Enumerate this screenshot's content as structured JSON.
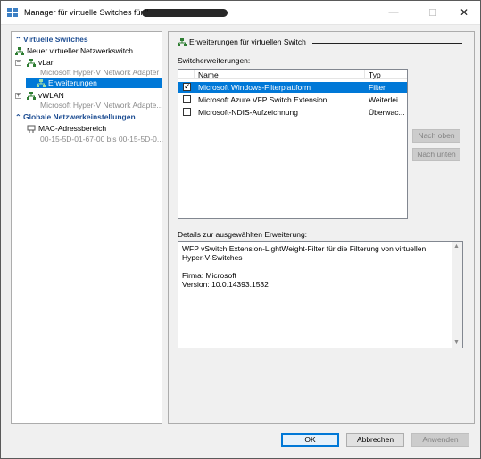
{
  "window": {
    "title": "Manager für virtuelle Switches für \"",
    "controls": {
      "minimize": "—",
      "maximize": "☐",
      "close": "✕"
    }
  },
  "tree": {
    "virtual_switches_header": "Virtuelle Switches",
    "new_switch": "Neuer virtueller Netzwerkswitch",
    "vlan": {
      "label": "vLan",
      "sub": "Microsoft Hyper-V Network Adapter",
      "child": "Erweiterungen"
    },
    "vwlan": {
      "label": "vWLAN",
      "sub": "Microsoft Hyper-V Network Adapte..."
    },
    "global_header": "Globale Netzwerkeinstellungen",
    "mac": {
      "label": "MAC-Adressbereich",
      "sub": "00-15-5D-01-67-00 bis 00-15-5D-0..."
    }
  },
  "panel": {
    "title": "Erweiterungen für virtuellen Switch",
    "switch_extensions_label": "Switcherweiterungen:",
    "columns": {
      "name": "Name",
      "type": "Typ"
    },
    "extensions": [
      {
        "name": "Microsoft Windows-Filterplattform",
        "type": "Filter",
        "checked": true,
        "selected": true
      },
      {
        "name": "Microsoft Azure VFP Switch Extension",
        "type": "Weiterlei...",
        "checked": false,
        "selected": false
      },
      {
        "name": "Microsoft-NDIS-Aufzeichnung",
        "type": "Überwac...",
        "checked": false,
        "selected": false
      }
    ],
    "move_up": "Nach oben",
    "move_down": "Nach unten",
    "details_label": "Details zur ausgewählten Erweiterung:",
    "details": {
      "description": "WFP vSwitch Extension-LightWeight-Filter für die Filterung von virtuellen Hyper-V-Switches",
      "company": "Firma: Microsoft",
      "version": "Version: 10.0.14393.1532"
    }
  },
  "buttons": {
    "ok": "OK",
    "cancel": "Abbrechen",
    "apply": "Anwenden"
  },
  "colors": {
    "selection": "#0078d7",
    "header_text": "#1e4e93"
  }
}
